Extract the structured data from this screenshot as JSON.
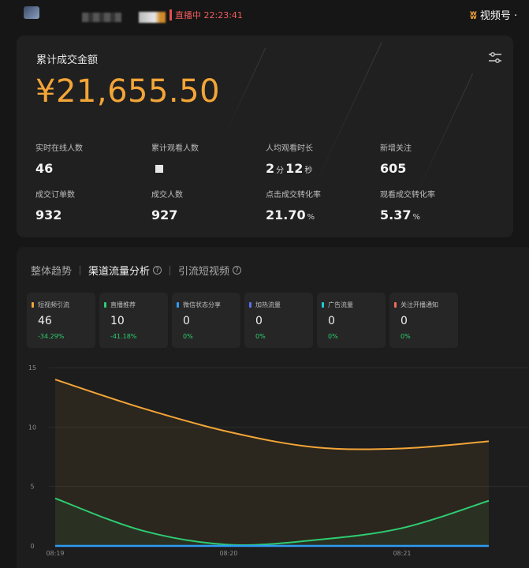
{
  "topbar": {
    "live_status": "直播中 22:23:41",
    "brand": "视频号 ·",
    "brand_icon": "channels-logo-icon"
  },
  "sales": {
    "title": "累计成交金额",
    "amount": "¥21,655.50",
    "filter_icon": "settings-sliders-icon",
    "metrics": [
      {
        "label": "实时在线人数",
        "value": "46"
      },
      {
        "label": "累计观看人数",
        "value": ""
      },
      {
        "label": "人均观看时长",
        "value_a": "2",
        "unit_a": "分",
        "value_b": "12",
        "unit_b": "秒"
      },
      {
        "label": "新增关注",
        "value": "605"
      },
      {
        "label": "成交订单数",
        "value": "932"
      },
      {
        "label": "成交人数",
        "value": "927"
      },
      {
        "label": "点击成交转化率",
        "value": "21.70",
        "unit": "%"
      },
      {
        "label": "观看成交转化率",
        "value": "5.37",
        "unit": "%"
      }
    ]
  },
  "tabs": [
    {
      "label": "整体趋势",
      "active": false
    },
    {
      "label": "渠道流量分析",
      "active": true
    },
    {
      "label": "引流短视频",
      "active": false
    }
  ],
  "channels": [
    {
      "name": "短视频引流",
      "value": "46",
      "change": "-34.29%",
      "color": "#f3a537"
    },
    {
      "name": "直播推荐",
      "value": "10",
      "change": "-41.18%",
      "color": "#2ecc71"
    },
    {
      "name": "微信状态分享",
      "value": "0",
      "change": "0%",
      "color": "#2f9bf3"
    },
    {
      "name": "加热流量",
      "value": "0",
      "change": "0%",
      "color": "#5b6ff0"
    },
    {
      "name": "广告流量",
      "value": "0",
      "change": "0%",
      "color": "#22c7d9"
    },
    {
      "name": "关注开播通知",
      "value": "0",
      "change": "0%",
      "color": "#f06a5a"
    }
  ],
  "colors": {
    "accent": "#f3a537",
    "positive": "#2ecc71",
    "live": "#f15b5b"
  },
  "chart_data": {
    "type": "line",
    "x": [
      "08:19",
      "08:19:30",
      "08:20",
      "08:20:30",
      "08:21",
      "08:21:30"
    ],
    "x_ticks": [
      "08:19",
      "08:20",
      "08:21"
    ],
    "y_ticks": [
      "0",
      "5",
      "10",
      "15"
    ],
    "ylim": [
      0,
      15
    ],
    "grid": true,
    "series": [
      {
        "key": "short_video",
        "color": "#f3a537",
        "values": [
          14,
          11.6,
          9.6,
          8.3,
          8.2,
          8.8
        ]
      },
      {
        "key": "live_recommend",
        "color": "#2ecc71",
        "values": [
          4,
          1.3,
          0.1,
          0.5,
          1.5,
          3.8
        ]
      },
      {
        "key": "wechat_share",
        "color": "#2f9bf3",
        "values": [
          0,
          0,
          0,
          0,
          0,
          0
        ]
      }
    ]
  }
}
